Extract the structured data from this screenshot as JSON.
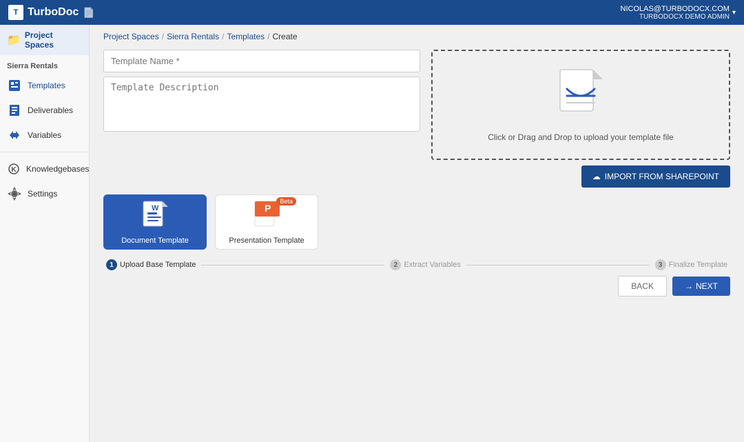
{
  "header": {
    "logo": "TurboDoc",
    "user_email": "NICOLAS@TURBODOCX.COM",
    "user_role": "TURBODOCX DEMO ADMIN"
  },
  "sidebar": {
    "project_spaces_label": "Project Spaces",
    "section_label": "Sierra Rentals",
    "items": [
      {
        "id": "templates",
        "label": "Templates",
        "active": true
      },
      {
        "id": "deliverables",
        "label": "Deliverables",
        "active": false
      },
      {
        "id": "variables",
        "label": "Variables",
        "active": false
      }
    ],
    "bottom_items": [
      {
        "id": "knowledgebases",
        "label": "Knowledgebases"
      },
      {
        "id": "settings",
        "label": "Settings"
      }
    ]
  },
  "breadcrumb": {
    "items": [
      {
        "label": "Project Spaces",
        "link": true
      },
      {
        "label": "Sierra Rentals",
        "link": true
      },
      {
        "label": "Templates",
        "link": true
      },
      {
        "label": "Create",
        "link": false
      }
    ]
  },
  "form": {
    "template_name_placeholder": "Template Name *",
    "template_description_placeholder": "Template Description"
  },
  "upload": {
    "text": "Click or Drag and Drop to upload your template file",
    "import_button_label": "IMPORT FROM SHAREPOINT"
  },
  "template_types": [
    {
      "id": "document",
      "label": "Document Template",
      "selected": true
    },
    {
      "id": "presentation",
      "label": "Presentation Template",
      "selected": false,
      "beta": true
    }
  ],
  "steps": [
    {
      "num": "1",
      "label": "Upload Base Template",
      "active": true
    },
    {
      "num": "2",
      "label": "Extract Variables",
      "active": false
    },
    {
      "num": "3",
      "label": "Finalize Template",
      "active": false
    }
  ],
  "actions": {
    "back_label": "BACK",
    "next_label": "NEXT"
  }
}
